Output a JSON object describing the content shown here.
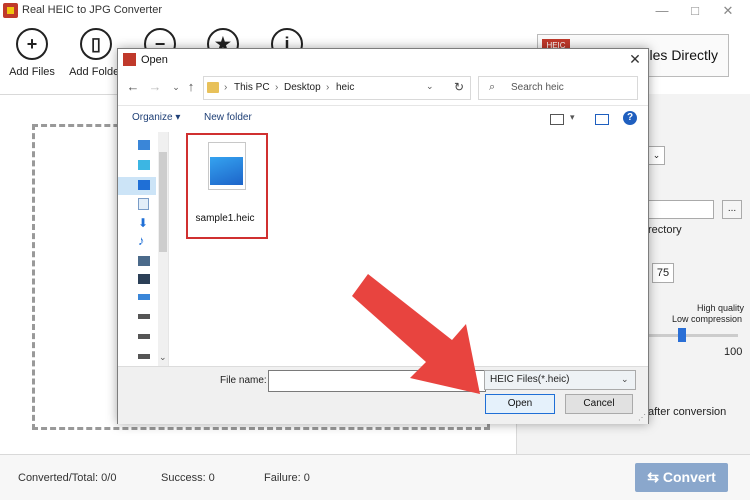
{
  "app": {
    "title": "Real HEIC to JPG Converter",
    "window_buttons": [
      "—",
      "□",
      "✕"
    ]
  },
  "toolbar": {
    "add_files_label": "Add Files",
    "add_folder_label": "Add Folder",
    "add_files_icon": "+",
    "add_folder_icon": "▯",
    "clear_icon": "−",
    "favorite_icon": "★",
    "info_icon": "i",
    "convert_direct_label": "Files Directly",
    "convert_direct_badge": "HEIC"
  },
  "right_pane": {
    "output_dir_fragment": "rectory",
    "quality_value": "75",
    "quality_high_label": "High quality",
    "quality_low_label": "Low compression",
    "slider_max": "100",
    "after_conversion_fragment": "after conversion",
    "browse_label": "...",
    "combo_arrow": "⌄"
  },
  "status": {
    "converted_total": "Converted/Total: 0/0",
    "success": "Success: 0",
    "failure": "Failure: 0",
    "convert_button": "Convert",
    "convert_icon": "⇆"
  },
  "dialog": {
    "title": "Open",
    "close_icon": "✕",
    "nav": {
      "back": "←",
      "forward": "→",
      "dropdown": "⌄",
      "up": "↑"
    },
    "breadcrumb": [
      "This PC",
      "Desktop",
      "heic"
    ],
    "breadcrumb_sep": "›",
    "addr_dropdown": "⌄",
    "refresh_icon": "↻",
    "search_placeholder": "Search heic",
    "search_icon": "⌕",
    "organize_label": "Organize ▾",
    "new_folder_label": "New folder",
    "view_dropdown": "▾",
    "help_icon": "?",
    "file": {
      "name": "sample1.heic"
    },
    "file_name_label": "File name:",
    "file_name_value": "",
    "file_type_value": "HEIC Files(*.heic)",
    "file_type_arrow": "⌄",
    "open_button": "Open",
    "cancel_button": "Cancel",
    "scroll_down": "⌄"
  },
  "colors": {
    "annotation_arrow": "#e8443f",
    "file_highlight": "#d03030",
    "convert_button": "#8aa7cc"
  }
}
